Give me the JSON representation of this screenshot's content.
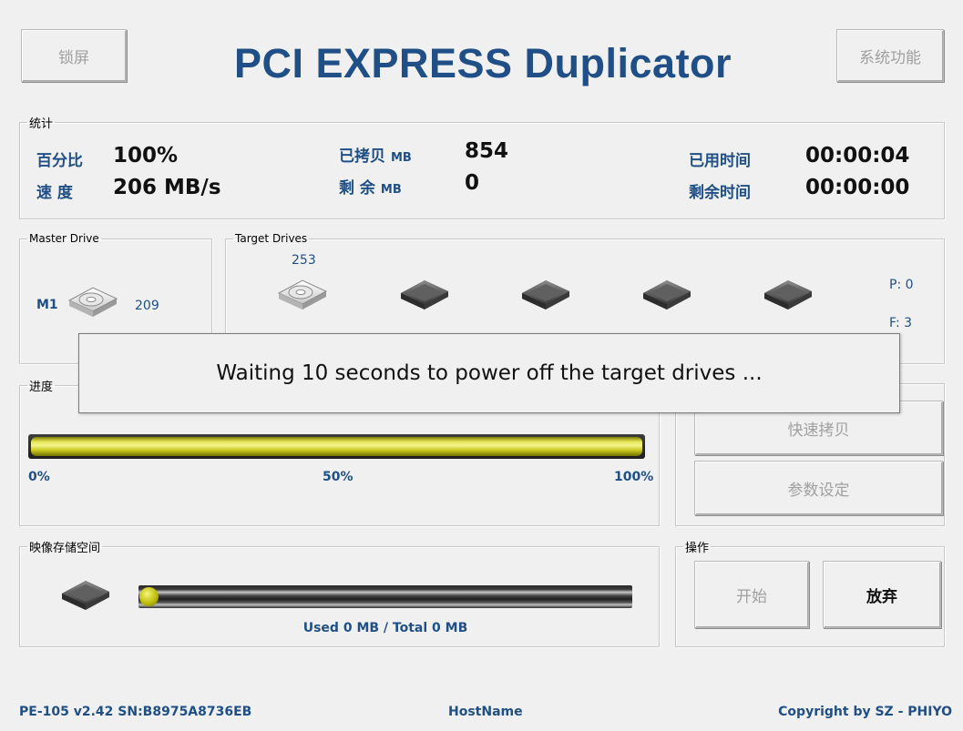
{
  "header": {
    "lock_label": "锁屏",
    "title": "PCI EXPRESS Duplicator",
    "system_label": "系统功能"
  },
  "stats": {
    "legend": "统计",
    "percent_label": "百分比",
    "percent_value": "100%",
    "speed_label": "速 度",
    "speed_value": "206 MB/s",
    "copied_label": "已拷贝",
    "copied_unit": "MB",
    "copied_value": "854",
    "remain_label": "剩 余",
    "remain_unit": "MB",
    "remain_value": "0",
    "elapsed_label": "已用时间",
    "elapsed_value": "00:00:04",
    "left_label": "剩余时间",
    "left_value": "00:00:00"
  },
  "master": {
    "legend": "Master Drive",
    "name": "M1",
    "value": "209"
  },
  "targets": {
    "legend": "Target Drives",
    "top_value": "253",
    "pass": "P: 0",
    "fail": "F: 3"
  },
  "progress": {
    "legend": "进度",
    "fraction": 1.0,
    "tick_0": "0%",
    "tick_50": "50%",
    "tick_100": "100%"
  },
  "side_buttons": {
    "fast_copy": "快速拷贝",
    "params": "参数设定"
  },
  "storage": {
    "legend": "映像存储空间",
    "usage_text": "Used 0 MB / Total 0 MB",
    "fraction": 0.0
  },
  "ops": {
    "legend": "操作",
    "start_label": "开始",
    "abort_label": "放弃"
  },
  "dialog": {
    "message": "Waiting 10 seconds to power off the target drives ..."
  },
  "footer": {
    "version": "PE-105 v2.42 SN:B8975A8736EB",
    "hostname": "HostName",
    "copyright": "Copyright by SZ - PHIYO"
  },
  "colors": {
    "accent": "#1f4f86",
    "progress_fill": "#e6e65a",
    "background": "#f0f0f0"
  }
}
